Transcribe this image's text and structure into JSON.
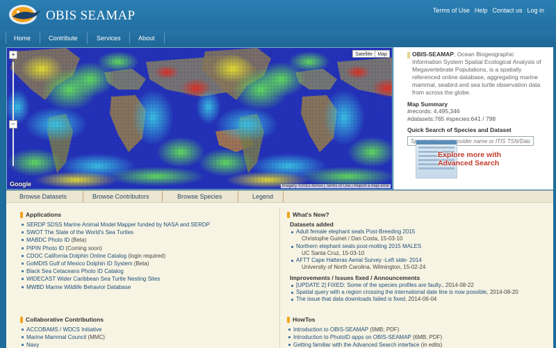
{
  "header": {
    "title": "OBIS SEAMAP",
    "links": [
      "Terms of Use",
      "Help",
      "Contact us",
      "Log in"
    ]
  },
  "nav": {
    "items": [
      "Home",
      "Contribute",
      "Services",
      "About"
    ]
  },
  "map": {
    "type_buttons": [
      "Satellite",
      "Map"
    ],
    "zoom_in": "+",
    "zoom_out": "−",
    "google_label": "Google",
    "attribution": "Imagery ©2015 NASA | Terms of Use | Report a map error",
    "colors": {
      "ocean_low": "#1f1c92",
      "ocean_mid": "#2a4fd0",
      "density_low": "#39c4e4",
      "density_mid": "#62e05a",
      "density_high": "#e8e02c",
      "density_max": "#e3301f"
    }
  },
  "side": {
    "intro_bold": "OBIS-SEAMAP",
    "intro_text": ", Ocean Biogeographic Information System Spatial Ecological Analysis of Megavertebrate Populations, is a spatially referenced online database, aggregating marine mammal, seabird and sea turtle observation data from across the globe.",
    "summary_title": "Map Summary",
    "records": "#records:  4,495,346",
    "datasets_species": "#datasets:765   #species:641 / 798",
    "quick_search_title": "Quick Search of Species and Dataset",
    "search_placeholder": "Species/dataset/provider name or ITIS TSN/Dataset ID",
    "advanced_line1": "Explore more with",
    "advanced_line2": "Advanced Search"
  },
  "tabs": [
    "Browse Datasets",
    "Browse Contributors",
    "Browse Species",
    "Legend"
  ],
  "applications": {
    "title": "Applications",
    "items": [
      {
        "link": "SERDP SDSS Marine Animal Model Mapper funded by NASA and SERDP",
        "note": ""
      },
      {
        "link": "SWOT The State of the World's Sea Turtles",
        "note": ""
      },
      {
        "link": "MABDC Photo ID",
        "note": " (Beta)"
      },
      {
        "link": "PIPIN Photo ID",
        "note": " (Coming soon)"
      },
      {
        "link": "CDOC California Dolphin Online Catalog",
        "note": " (login required)"
      },
      {
        "link": "GoMDIS Gulf of Mexico Dolphin ID System",
        "note": " (Beta)"
      },
      {
        "link": "Black Sea Cetaceans Photo ID Catalog",
        "note": ""
      },
      {
        "link": "WIDECAST Wider Caribbean Sea Turtle Nesting Sites",
        "note": ""
      },
      {
        "link": "MWBD Marine Wildlife Behavior Database",
        "note": ""
      }
    ]
  },
  "collab": {
    "title": "Collaborative Contributions",
    "items": [
      {
        "link": "ACCOBAMS / WDCS Initiative",
        "note": ""
      },
      {
        "link": "Marine Mammal Council",
        "note": " (MMC)"
      },
      {
        "link": "Navy",
        "note": ""
      }
    ]
  },
  "whats_new": {
    "title": "What's New?",
    "datasets_title": "Datasets added",
    "datasets": [
      {
        "link": "Adult female elephant seals Post-Breeding 2015",
        "sub": "Christophe Guinet / Dan Costa, 15-03-10"
      },
      {
        "link": "Northern elephant seals post-molting 2015 MALES",
        "sub": "UC Santa Cruz, 15-03-10"
      },
      {
        "link": "AFTT Cape Hatteras Aerial Survey -Left side- 2014",
        "sub": "University of North Carolina, Wilmington, 15-02-24"
      }
    ],
    "improvements_title": "Improvements / Issues fixed / Announcements",
    "improvements": [
      {
        "link": "[UPDATE 2] FIXED: Some of the species profiles are faulty.",
        "date": ", 2014-08-22"
      },
      {
        "link": "Spatial query with a region crossing the international date line is now possible",
        "date": ", 2014-08-20"
      },
      {
        "link": "The issue that data downloads failed is fixed",
        "date": ", 2014-06-04"
      }
    ]
  },
  "howtos": {
    "title": "HowTos",
    "items": [
      {
        "link": "Introduction to OBIS-SEAMAP",
        "note": " (9MB; PDF)"
      },
      {
        "link": "Introduction to PhotoID apps on OBIS-SEAMAP",
        "note": " (6MB; PDF)"
      },
      {
        "link": "Getting familiar with the Advanced Search interface",
        "note": " (in edits)"
      }
    ]
  }
}
